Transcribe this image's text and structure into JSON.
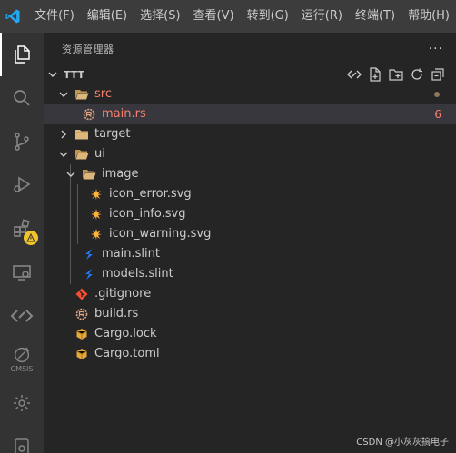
{
  "menu": [
    {
      "id": "file",
      "label": "文件(F)"
    },
    {
      "id": "edit",
      "label": "编辑(E)"
    },
    {
      "id": "selection",
      "label": "选择(S)"
    },
    {
      "id": "view",
      "label": "查看(V)"
    },
    {
      "id": "go",
      "label": "转到(G)"
    },
    {
      "id": "run",
      "label": "运行(R)"
    },
    {
      "id": "terminal",
      "label": "终端(T)"
    },
    {
      "id": "help",
      "label": "帮助(H)"
    }
  ],
  "activity_bar": {
    "items": [
      "files-icon",
      "search-icon",
      "source-control-icon",
      "run-debug-icon",
      "extensions-icon",
      "remote-explorer-icon",
      "code-icon",
      "cmsis-icon",
      "settings-gear-icon",
      "package-icon"
    ],
    "cmsis_label": "CMSIS"
  },
  "sidebar": {
    "title": "资源管理器",
    "more": "···",
    "section_title": "TTT"
  },
  "tree": [
    {
      "name": "src",
      "depth": 0,
      "kind": "folder",
      "expanded": true,
      "color": "err",
      "status": "dot"
    },
    {
      "name": "main.rs",
      "depth": 1,
      "kind": "rust",
      "selected": true,
      "color": "err",
      "status": "6"
    },
    {
      "name": "target",
      "depth": 0,
      "kind": "folder",
      "expanded": false
    },
    {
      "name": "ui",
      "depth": 0,
      "kind": "folder",
      "expanded": true
    },
    {
      "name": "image",
      "depth": 1,
      "kind": "folder",
      "expanded": true
    },
    {
      "name": "icon_error.svg",
      "depth": 2,
      "kind": "svg"
    },
    {
      "name": "icon_info.svg",
      "depth": 2,
      "kind": "svg"
    },
    {
      "name": "icon_warning.svg",
      "depth": 2,
      "kind": "svg"
    },
    {
      "name": "main.slint",
      "depth": 1,
      "kind": "slint"
    },
    {
      "name": "models.slint",
      "depth": 1,
      "kind": "slint"
    },
    {
      "name": ".gitignore",
      "depth": 0,
      "kind": "git"
    },
    {
      "name": "build.rs",
      "depth": 0,
      "kind": "rust"
    },
    {
      "name": "Cargo.lock",
      "depth": 0,
      "kind": "cargo"
    },
    {
      "name": "Cargo.toml",
      "depth": 0,
      "kind": "cargo"
    }
  ],
  "watermark": "CSDN @小灰灰搞电子",
  "colors": {
    "accent": "#23a8f2",
    "error_text": "#f88070",
    "folder": "#dcb67a",
    "svg_icon": "#ffb13b"
  }
}
